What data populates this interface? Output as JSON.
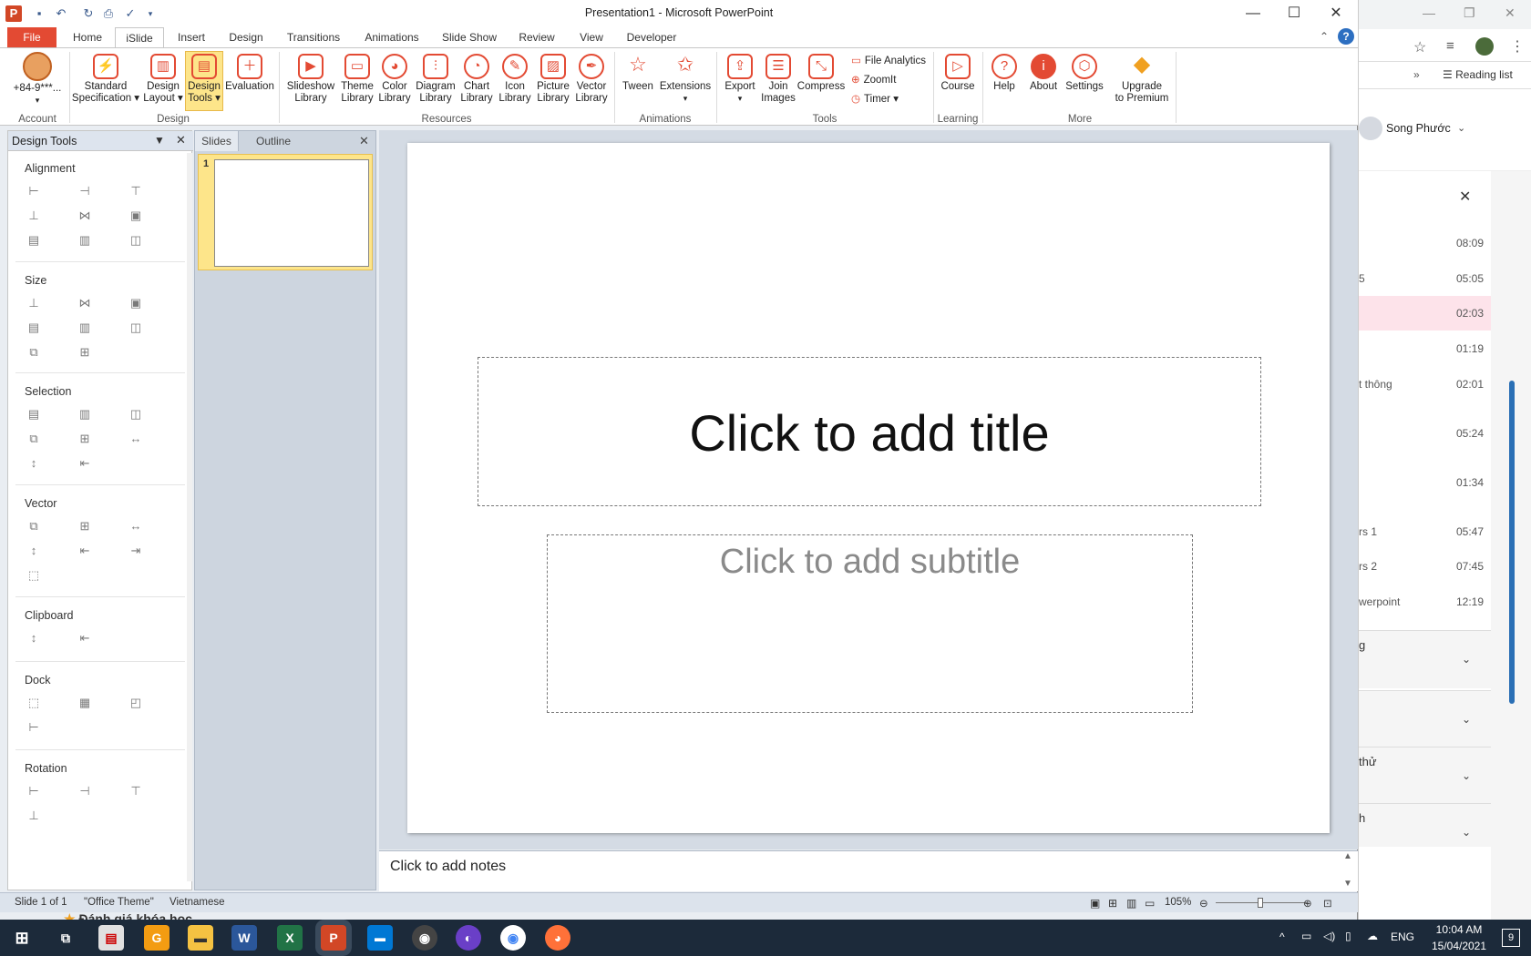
{
  "window": {
    "title": "Presentation1 - Microsoft PowerPoint"
  },
  "tabs": [
    "File",
    "Home",
    "iSlide",
    "Insert",
    "Design",
    "Transitions",
    "Animations",
    "Slide Show",
    "Review",
    "View",
    "Developer"
  ],
  "ribbon": {
    "account": {
      "label": "+84-9***...",
      "group": "Account"
    },
    "design_group": {
      "label": "Design",
      "buttons": [
        {
          "l1": "Standard",
          "l2": "Specification ▾",
          "icon": "standard-spec-icon"
        },
        {
          "l1": "Design",
          "l2": "Layout ▾",
          "icon": "design-layout-icon"
        },
        {
          "l1": "Design",
          "l2": "Tools ▾",
          "icon": "design-tools-icon"
        },
        {
          "l1": "Evaluation",
          "l2": "",
          "icon": "evaluation-icon"
        }
      ]
    },
    "resources_group": {
      "label": "Resources",
      "buttons": [
        {
          "l1": "Slideshow",
          "l2": "Library"
        },
        {
          "l1": "Theme",
          "l2": "Library"
        },
        {
          "l1": "Color",
          "l2": "Library"
        },
        {
          "l1": "Diagram",
          "l2": "Library"
        },
        {
          "l1": "Chart",
          "l2": "Library"
        },
        {
          "l1": "Icon",
          "l2": "Library"
        },
        {
          "l1": "Picture",
          "l2": "Library"
        },
        {
          "l1": "Vector",
          "l2": "Library"
        }
      ]
    },
    "animations_group": {
      "label": "Animations",
      "buttons": [
        {
          "l1": "Tween",
          "l2": ""
        },
        {
          "l1": "Extensions",
          "l2": "▾"
        }
      ]
    },
    "tools_group": {
      "label": "Tools",
      "buttons": [
        {
          "l1": "Export",
          "l2": "▾"
        },
        {
          "l1": "Join",
          "l2": "Images"
        },
        {
          "l1": "Compress",
          "l2": ""
        }
      ],
      "small": [
        "File Analytics",
        "ZoomIt",
        "Timer ▾"
      ]
    },
    "learning_group": {
      "label": "Learning",
      "buttons": [
        {
          "l1": "Course",
          "l2": ""
        }
      ]
    },
    "more_group": {
      "label": "More",
      "buttons": [
        {
          "l1": "Help",
          "l2": ""
        },
        {
          "l1": "About",
          "l2": ""
        },
        {
          "l1": "Settings",
          "l2": ""
        },
        {
          "l1": "Upgrade",
          "l2": "to Premium"
        }
      ]
    }
  },
  "design_tools_pane": {
    "title": "Design Tools",
    "sections": [
      "Alignment",
      "Size",
      "Selection",
      "Vector",
      "Clipboard",
      "Dock",
      "Rotation"
    ]
  },
  "slides_pane": {
    "tabs": [
      "Slides",
      "Outline"
    ],
    "slide_number": "1"
  },
  "slide": {
    "title_placeholder": "Click to add title",
    "subtitle_placeholder": "Click to add subtitle"
  },
  "notes": {
    "placeholder": "Click to add notes"
  },
  "status": {
    "slide_info": "Slide 1 of 1",
    "theme": "\"Office Theme\"",
    "language": "Vietnamese",
    "zoom": "105%"
  },
  "browser": {
    "reading_list": "Reading list",
    "user": "Song Phước",
    "rows": [
      {
        "snippet": "",
        "time": "08:09"
      },
      {
        "snippet": "5",
        "time": "05:05"
      },
      {
        "snippet": "",
        "time": "02:03"
      },
      {
        "snippet": "",
        "time": "01:19"
      },
      {
        "snippet": "t thông",
        "time": "02:01"
      },
      {
        "snippet": "",
        "time": "05:24"
      },
      {
        "snippet": "",
        "time": "01:34"
      },
      {
        "snippet": "rs 1",
        "time": "05:47"
      },
      {
        "snippet": "rs 2",
        "time": "07:45"
      },
      {
        "snippet": "werpoint",
        "time": "12:19"
      }
    ],
    "sections": [
      "g",
      "",
      "thử",
      "h"
    ]
  },
  "taskbar": {
    "time": "10:04 AM",
    "date": "15/04/2021",
    "lang": "ENG",
    "notif_count": "9",
    "partial_text": "Đánh giá khóa học"
  },
  "colors": {
    "accent": "#e34a33",
    "highlight": "#fde58a"
  }
}
